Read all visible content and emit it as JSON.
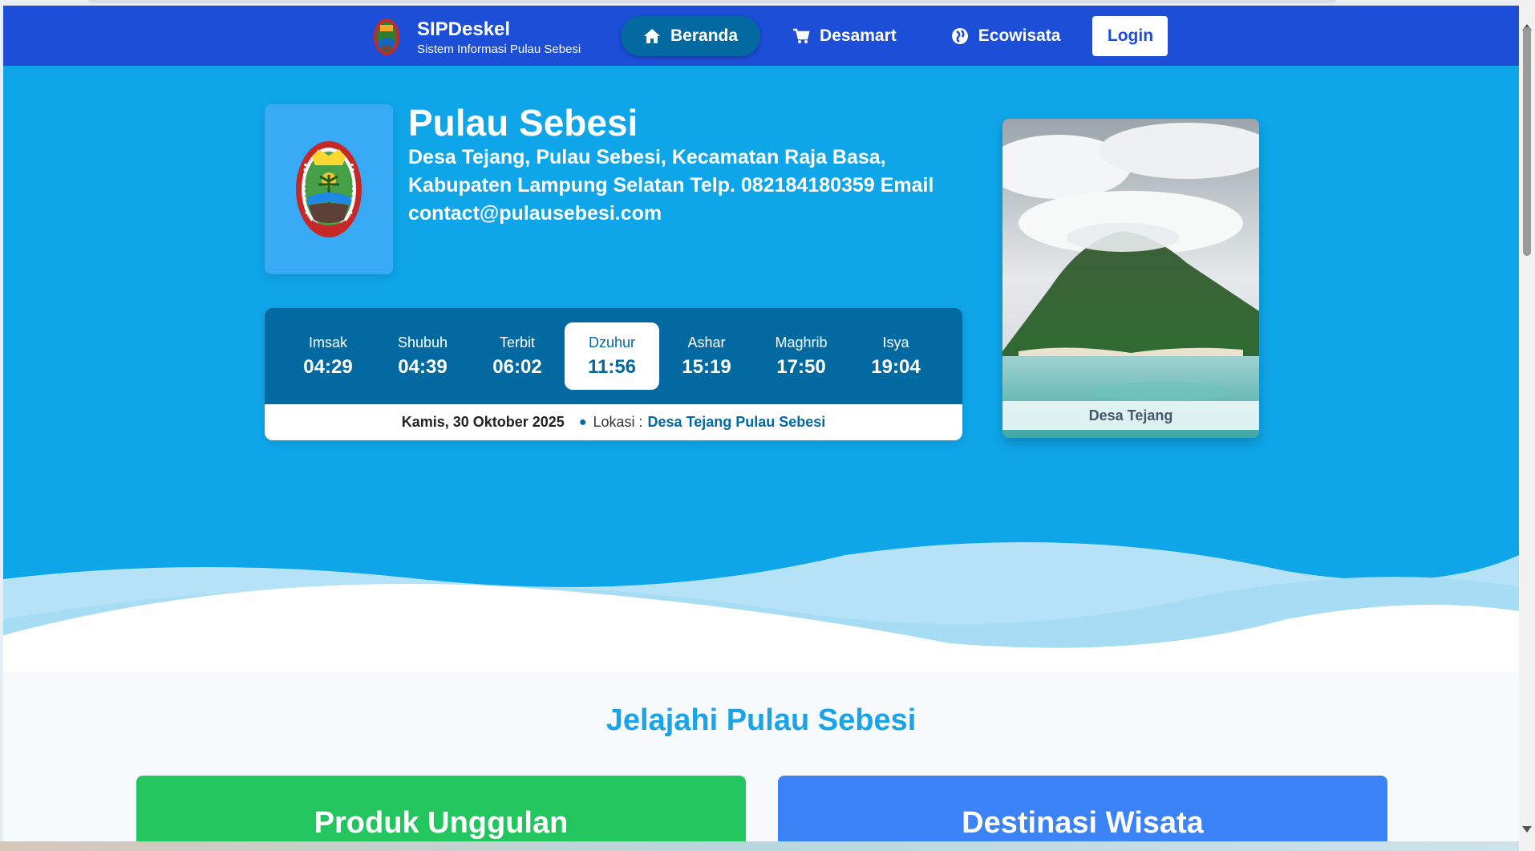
{
  "navbar": {
    "brand_title": "SIPDeskel",
    "brand_subtitle": "Sistem Informasi Pulau Sebesi",
    "items": [
      {
        "label": "Beranda",
        "icon": "home-icon",
        "active": true
      },
      {
        "label": "Desamart",
        "icon": "cart-icon",
        "active": false
      },
      {
        "label": "Ecowisata",
        "icon": "leaf-icon",
        "active": false
      }
    ],
    "login_label": "Login"
  },
  "hero": {
    "name": "Pulau Sebesi",
    "address": "Desa Tejang, Pulau Sebesi, Kecamatan Raja Basa, Kabupaten Lampung Selatan Telp. 082184180359 Email contact@pulausebesi.com",
    "photo_caption": "Desa Tejang"
  },
  "prayer": {
    "times": [
      {
        "name": "Imsak",
        "time": "04:29"
      },
      {
        "name": "Shubuh",
        "time": "04:39"
      },
      {
        "name": "Terbit",
        "time": "06:02"
      },
      {
        "name": "Dzuhur",
        "time": "11:56"
      },
      {
        "name": "Ashar",
        "time": "15:19"
      },
      {
        "name": "Maghrib",
        "time": "17:50"
      },
      {
        "name": "Isya",
        "time": "19:04"
      }
    ],
    "active_index": 3,
    "date": "Kamis, 30 Oktober 2025",
    "location_label": "Lokasi :",
    "location_value": "Desa Tejang Pulau Sebesi"
  },
  "section": {
    "title": "Jelajahi Pulau Sebesi",
    "cards": [
      "Produk Unggulan",
      "Destinasi Wisata"
    ]
  },
  "colors": {
    "navbar": "#1d4ed8",
    "hero": "#0ea5e9",
    "active_nav": "#0369a1",
    "green_card": "#22c55e",
    "blue_card": "#3b82f6"
  }
}
